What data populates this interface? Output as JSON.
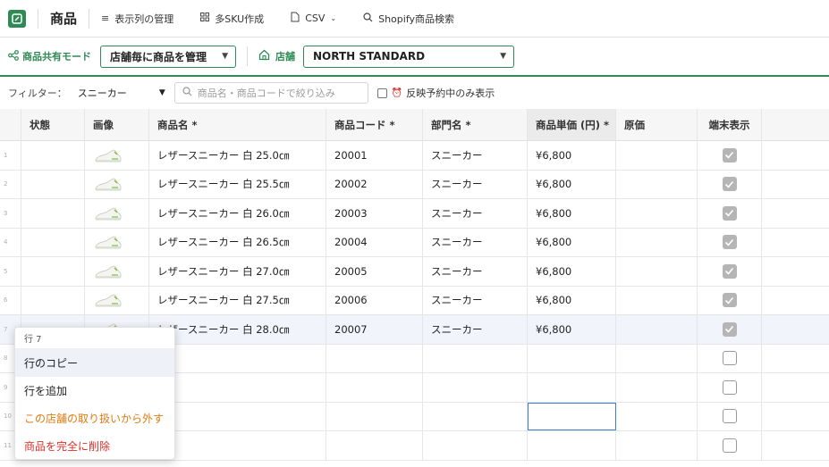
{
  "app": {
    "title": "商品"
  },
  "toolbar": {
    "columns_label": "表示列の管理",
    "multi_sku_label": "多SKU作成",
    "csv_label": "CSV",
    "shopify_label": "Shopify商品検索"
  },
  "mode_bar": {
    "share_mode_label": "商品共有モード",
    "share_mode_value": "店舗毎に商品を管理",
    "store_label": "店舗",
    "store_value": "NORTH STANDARD"
  },
  "filter": {
    "label": "フィルター：",
    "category_value": "スニーカー",
    "search_placeholder": "商品名・商品コードで絞り込み",
    "reservation_only_label": "反映予約中のみ表示"
  },
  "table": {
    "headers": {
      "status": "状態",
      "image": "画像",
      "name": "商品名 *",
      "code": "商品コード *",
      "department": "部門名 *",
      "unit_price": "商品単価 (円) *",
      "cost": "原価",
      "terminal": "端末表示"
    },
    "rows": [
      {
        "num": "1",
        "name": "レザースニーカー 白 25.0㎝",
        "code": "20001",
        "department": "スニーカー",
        "price": "¥6,800",
        "terminal": true
      },
      {
        "num": "2",
        "name": "レザースニーカー 白 25.5㎝",
        "code": "20002",
        "department": "スニーカー",
        "price": "¥6,800",
        "terminal": true
      },
      {
        "num": "3",
        "name": "レザースニーカー 白 26.0㎝",
        "code": "20003",
        "department": "スニーカー",
        "price": "¥6,800",
        "terminal": true
      },
      {
        "num": "4",
        "name": "レザースニーカー 白 26.5㎝",
        "code": "20004",
        "department": "スニーカー",
        "price": "¥6,800",
        "terminal": true
      },
      {
        "num": "5",
        "name": "レザースニーカー 白 27.0㎝",
        "code": "20005",
        "department": "スニーカー",
        "price": "¥6,800",
        "terminal": true
      },
      {
        "num": "6",
        "name": "レザースニーカー 白 27.5㎝",
        "code": "20006",
        "department": "スニーカー",
        "price": "¥6,800",
        "terminal": true
      },
      {
        "num": "7",
        "name": "レザースニーカー 白 28.0㎝",
        "code": "20007",
        "department": "スニーカー",
        "price": "¥6,800",
        "terminal": true
      },
      {
        "num": "8",
        "name": "",
        "code": "",
        "department": "",
        "price": "",
        "terminal": false
      },
      {
        "num": "9",
        "name": "",
        "code": "",
        "department": "",
        "price": "",
        "terminal": false
      },
      {
        "num": "10",
        "name": "",
        "code": "",
        "department": "",
        "price": "",
        "terminal": false
      },
      {
        "num": "11",
        "name": "",
        "code": "",
        "department": "",
        "price": "",
        "terminal": false
      }
    ]
  },
  "context_menu": {
    "title": "行 7",
    "copy_row": "行のコピー",
    "add_row": "行を追加",
    "remove_from_store": "この店舗の取り扱いから外す",
    "delete_product": "商品を完全に削除"
  },
  "colors": {
    "brand_green": "#2f8a55",
    "selection_blue": "#3b7dd8",
    "warning_orange": "#e07a10",
    "danger_red": "#d6332a"
  }
}
